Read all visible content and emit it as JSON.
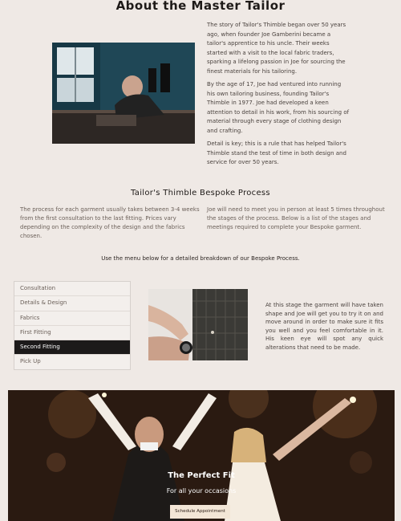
{
  "about": {
    "title": "About the Master Tailor",
    "paragraphs": [
      "The story of Tailor's Thimble began over 50 years ago, when founder Joe Gamberini became a tailor's apprentice to his uncle. Their weeks started with a visit to the local fabric traders, sparking a lifelong passion in Joe for sourcing the finest materials for his tailoring.",
      "By the age of 17, Joe had ventured into running his own tailoring business, founding Tailor's Thimble in 1977. Joe had developed a keen attention to detail in his work, from his sourcing of material through every stage of clothing design and crafting.",
      "Detail is key; this is a rule that has helped Tailor's Thimble stand the test of time in both design and service for over 50 years."
    ]
  },
  "process": {
    "title": "Tailor's Thimble Bespoke Process",
    "left_text": "The process for each garment usually takes between 3-4 weeks from the first consultation to the last fitting. Prices vary depending on the complexity of the design and the fabrics chosen.",
    "right_text": "Joe will need to meet you in person at least 5 times throughout the stages of the process. Below is a list of the stages and meetings required to complete your Bespoke garment.",
    "menu_note": "Use the menu below for a detailed breakdown of our Bespoke Process."
  },
  "menu": {
    "items": [
      "Consultation",
      "Details & Design",
      "Fabrics",
      "First Fitting",
      "Second Fitting",
      "Pick Up"
    ],
    "active_index": 4
  },
  "stage": {
    "text": "At this stage the garment will have taken shape and Joe will get you to try it on and move around in order to make sure it fits you well and you feel comfortable in it. His keen eye will spot any quick alterations that need to be made."
  },
  "hero": {
    "title": "The Perfect Fit",
    "subtitle": "For all your occasions",
    "button_label": "Schedule Appointment"
  },
  "colors": {
    "background": "#efe9e5",
    "active_menu": "#1c1a1a",
    "button": "#f3e6d6"
  }
}
